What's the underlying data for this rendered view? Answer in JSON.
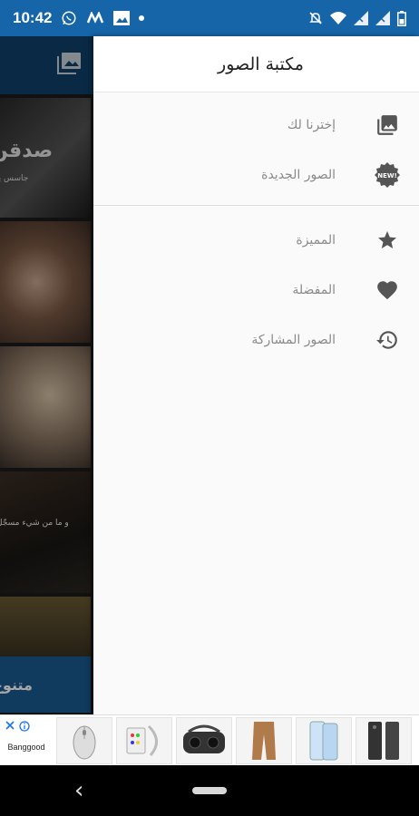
{
  "status_bar": {
    "time": "10:42",
    "icons_left": [
      "whatsapp-icon",
      "m-app-icon",
      "image-notification-icon",
      "dot-icon"
    ],
    "icons_right": [
      "mute-icon",
      "wifi-icon",
      "signal-icon",
      "signal-icon",
      "battery-icon"
    ]
  },
  "background_app": {
    "tiles": [
      {
        "text": "صدقن",
        "sub": "جاسس يو"
      },
      {},
      {},
      {
        "caption": "و ما من شيء مسجّل"
      },
      {},
      {
        "text": "متنوع"
      }
    ]
  },
  "drawer": {
    "title": "مكتبة الصور",
    "groups": [
      {
        "items": [
          {
            "label": "إخترنا لك",
            "icon": "photo-library-icon"
          },
          {
            "label": "الصور الجديدة",
            "icon": "new-badge-icon"
          }
        ]
      },
      {
        "items": [
          {
            "label": "المميزة",
            "icon": "star-icon"
          },
          {
            "label": "المفضلة",
            "icon": "heart-icon"
          },
          {
            "label": "الصور المشاركة",
            "icon": "history-icon"
          }
        ]
      }
    ]
  },
  "ad": {
    "brand": "Banggood",
    "products": [
      "mouse",
      "led-strip",
      "vr-headset",
      "pants",
      "phone",
      "phone-case"
    ]
  },
  "colors": {
    "status_bar": "#1565a8",
    "drawer_bg": "#fafafa",
    "icon": "#555555",
    "label": "#8a8a8a"
  }
}
